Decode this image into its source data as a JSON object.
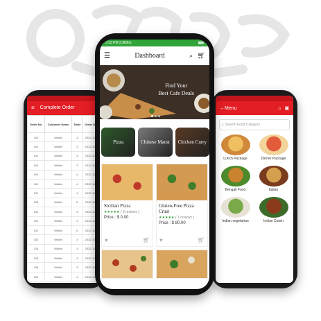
{
  "left_phone": {
    "title": "Complete Order",
    "columns": [
      "Order No.",
      "Customer Name",
      "Table",
      "Order Date"
    ],
    "rows": [
      [
        "140",
        "Walkin",
        "3",
        "2022-11-11"
      ],
      [
        "141",
        "Walkin",
        "3",
        "2022-11-11"
      ],
      [
        "142",
        "Walkin",
        "3",
        "2022-11-11"
      ],
      [
        "143",
        "Walkin",
        "3",
        "2022-11-11"
      ],
      [
        "144",
        "Walkin",
        "4",
        "2022-11-11"
      ],
      [
        "145",
        "Walkin",
        "4",
        "2022-11-11"
      ],
      [
        "137",
        "Walkin",
        "4",
        "2022-11-11"
      ],
      [
        "138",
        "Walkin",
        "5",
        "2022-11-11"
      ],
      [
        "130",
        "Walkin",
        "3",
        "2022-11-11"
      ],
      [
        "131",
        "Walkin",
        "4",
        "2022-11-11"
      ],
      [
        "132",
        "Walkin",
        "5",
        "2022-11-11"
      ],
      [
        "133",
        "Walkin",
        "3",
        "2022-11-11"
      ],
      [
        "134",
        "Walkin",
        "3",
        "2022-11-11"
      ],
      [
        "135",
        "Walkin",
        "3",
        "2022-11-11"
      ],
      [
        "136",
        "Walkin",
        "3",
        "2022-11-11"
      ],
      [
        "128",
        "Walkin",
        "4",
        "2022-11-11"
      ]
    ]
  },
  "center_phone": {
    "status_time": "3:33 PM",
    "status_speed": "2.9KB/s",
    "title": "Dashboard",
    "hero_line1": "Find Your",
    "hero_line2": "Best Cafe Deals",
    "cafes": [
      "Pizza",
      "Chinese Maust",
      "Chicken Curry"
    ],
    "products": [
      {
        "name": "Sicilian Pizza",
        "reviews": "( 3 reviews )",
        "price": "Price : $ 0.00"
      },
      {
        "name": "Gluten-Free Pizza Crust",
        "reviews": "( 1 reviews )",
        "price": "Price : $ 80.00"
      }
    ]
  },
  "right_phone": {
    "title": "Menu",
    "search_placeholder": "Search Food Category",
    "categories": [
      "Lunch Package",
      "Dinner Package",
      "Bengali Food",
      "Italian",
      "Indian vegetarian",
      "Indian Cuisin"
    ]
  },
  "colors": {
    "accent_red": "#e31e24",
    "status_green": "#31a53a",
    "star_green": "#2c9b3a"
  }
}
